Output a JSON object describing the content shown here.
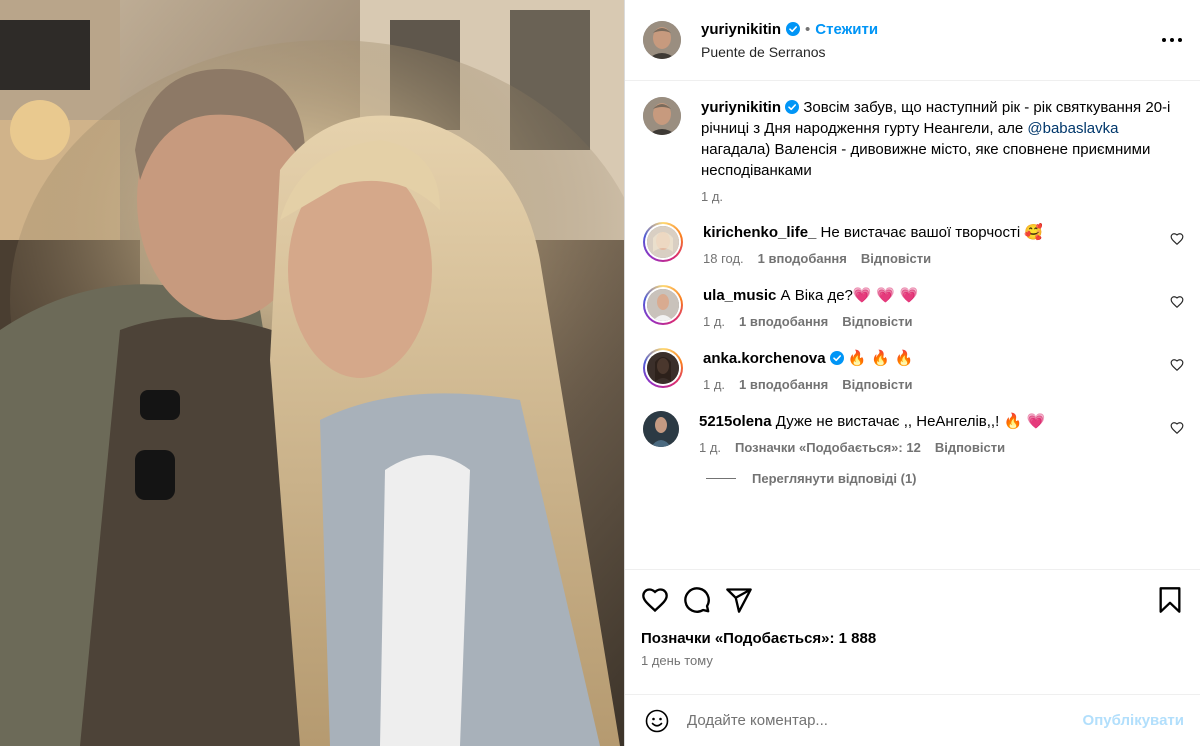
{
  "post": {
    "author": "yuriynikitin",
    "separator": "•",
    "follow_label": "Стежити",
    "location": "Puente de Serranos",
    "more_label": "Інші параметри"
  },
  "caption": {
    "user": "yuriynikitin",
    "text_before": " Зовсім забув, що наступний рік - рік святкування 20-і річниці з Дня народження гурту Неангели, але ",
    "mention": "@babaslavka",
    "text_after": " нагадала) Валенсія - дивовижне місто, яке сповнене приємними несподіванками",
    "time": "1 д."
  },
  "comments": [
    {
      "user": "kirichenko_life_",
      "verified": false,
      "text": " Не вистачає вашої творчості ",
      "emoji": "🥰",
      "time": "18 год.",
      "likes": "1 вподобання",
      "reply": "Відповісти"
    },
    {
      "user": "ula_music",
      "verified": false,
      "text": " А Віка де?",
      "emoji": "💗 💗 💗",
      "time": "1 д.",
      "likes": "1 вподобання",
      "reply": "Відповісти"
    },
    {
      "user": "anka.korchenova",
      "verified": true,
      "text": " ",
      "emoji": "🔥 🔥 🔥",
      "time": "1 д.",
      "likes": "1 вподобання",
      "reply": "Відповісти"
    },
    {
      "user": "5215olena",
      "verified": false,
      "text": " Дуже не вистачає ,, НеАнгелів,,! ",
      "emoji": "🔥 💗",
      "time": "1 д.",
      "likes": "Позначки «Подобається»: 12",
      "reply": "Відповісти"
    }
  ],
  "replies_label": "Переглянути відповіді (1)",
  "likes_total": "Позначки «Подобається»: 1 888",
  "posted_ago": "1 день тому",
  "composer": {
    "placeholder": "Додайте коментар...",
    "post_label": "Опублікувати"
  },
  "colors": {
    "accent": "#0095f6",
    "verified": "#0095f6",
    "post_disabled": "#b2dffc",
    "muted": "#737373"
  }
}
